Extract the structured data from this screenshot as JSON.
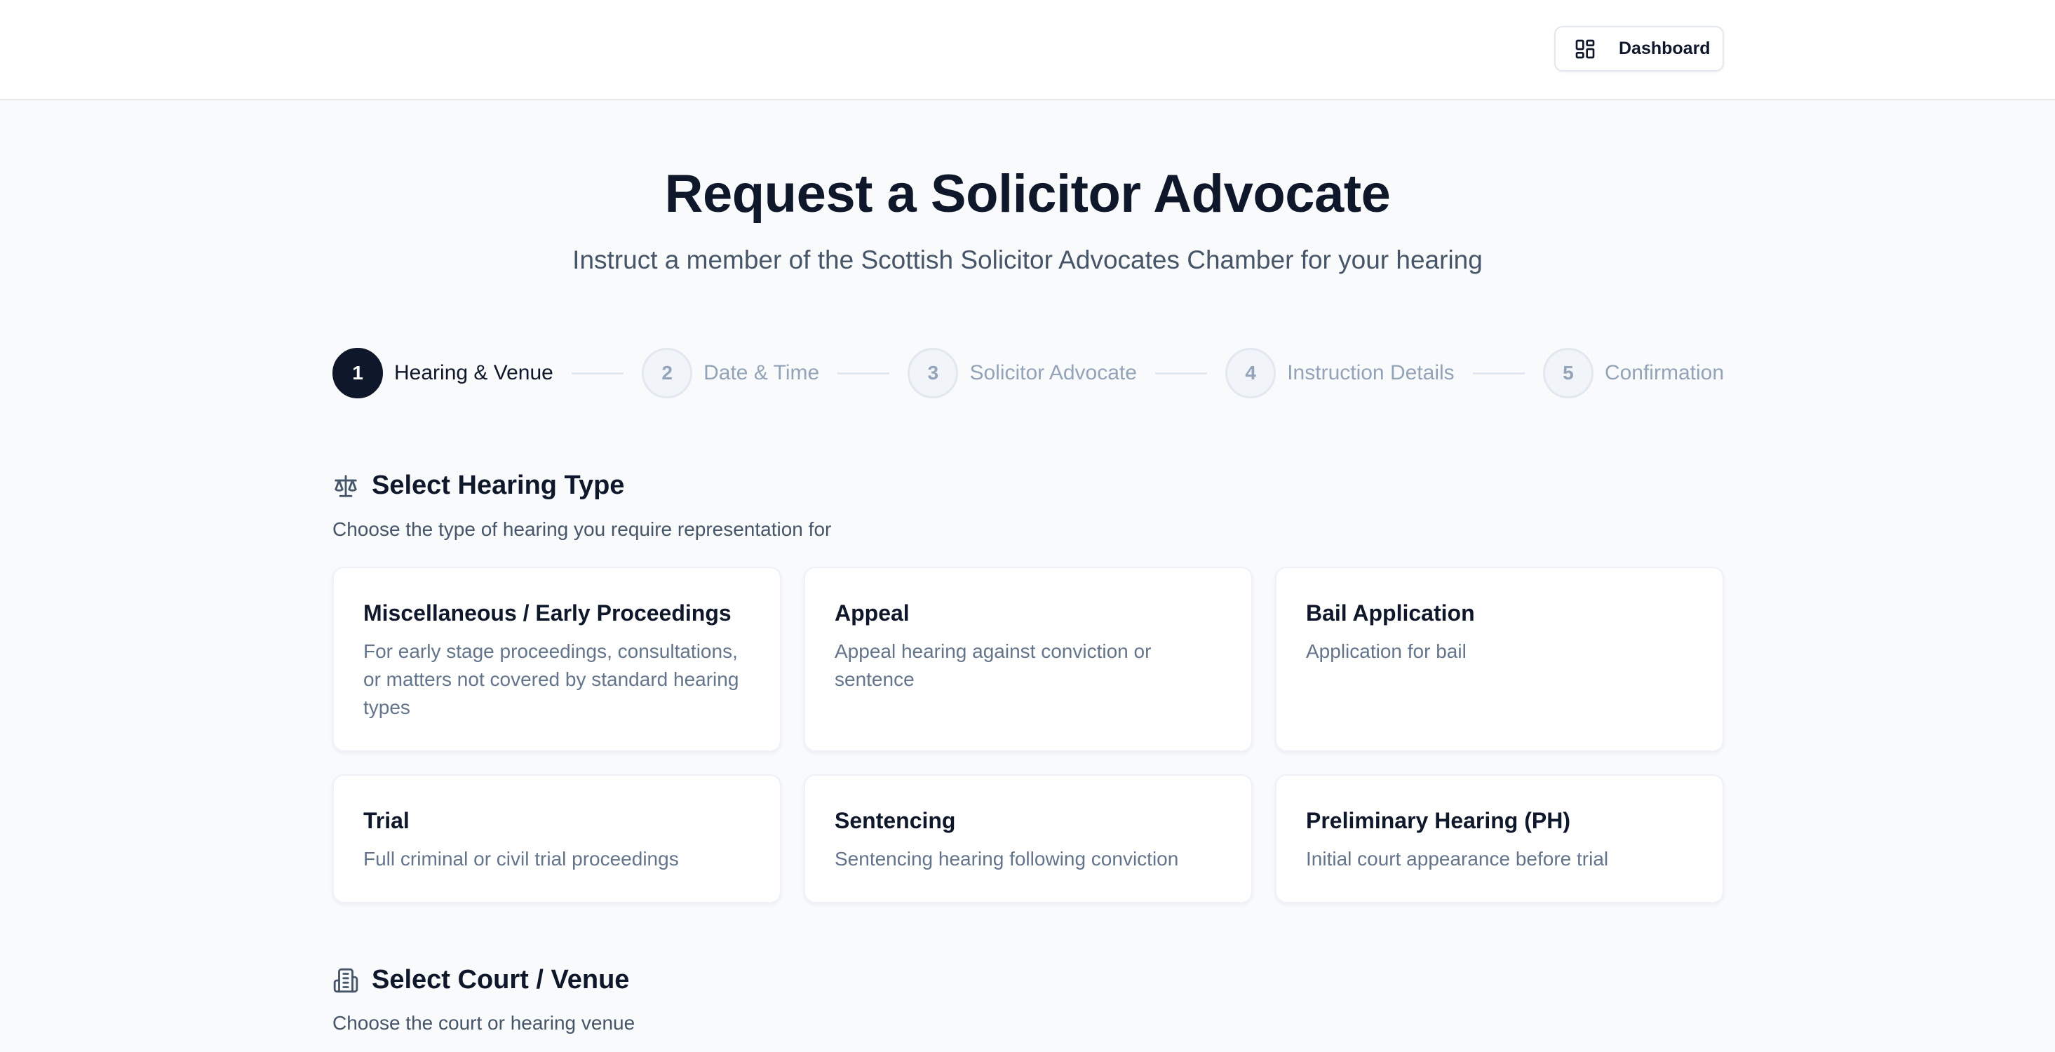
{
  "header": {
    "dashboard_label": "Dashboard",
    "dashboard_icon": "layout-dashboard-icon"
  },
  "page": {
    "title": "Request a Solicitor Advocate",
    "subtitle": "Instruct a member of the Scottish Solicitor Advocates Chamber for your hearing"
  },
  "steps": [
    {
      "number": "1",
      "label": "Hearing & Venue",
      "active": true
    },
    {
      "number": "2",
      "label": "Date & Time",
      "active": false
    },
    {
      "number": "3",
      "label": "Solicitor Advocate",
      "active": false
    },
    {
      "number": "4",
      "label": "Instruction Details",
      "active": false
    },
    {
      "number": "5",
      "label": "Confirmation",
      "active": false
    }
  ],
  "hearing_section": {
    "icon": "scale-icon",
    "title": "Select Hearing Type",
    "description": "Choose the type of hearing you require representation for",
    "cards": [
      {
        "title": "Miscellaneous / Early Proceedings",
        "description": "For early stage proceedings, consultations, or matters not covered by standard hearing types"
      },
      {
        "title": "Appeal",
        "description": "Appeal hearing against conviction or sentence"
      },
      {
        "title": "Bail Application",
        "description": "Application for bail"
      },
      {
        "title": "Trial",
        "description": "Full criminal or civil trial proceedings"
      },
      {
        "title": "Sentencing",
        "description": "Sentencing hearing following conviction"
      },
      {
        "title": "Preliminary Hearing (PH)",
        "description": "Initial court appearance before trial"
      }
    ]
  },
  "venue_section": {
    "icon": "building-icon",
    "title": "Select Court / Venue",
    "description": "Choose the court or hearing venue"
  },
  "colors": {
    "primary": "#0f172a",
    "muted_text": "#64748b",
    "inactive_step": "#94a3b8",
    "page_background": "#f8fafc"
  }
}
